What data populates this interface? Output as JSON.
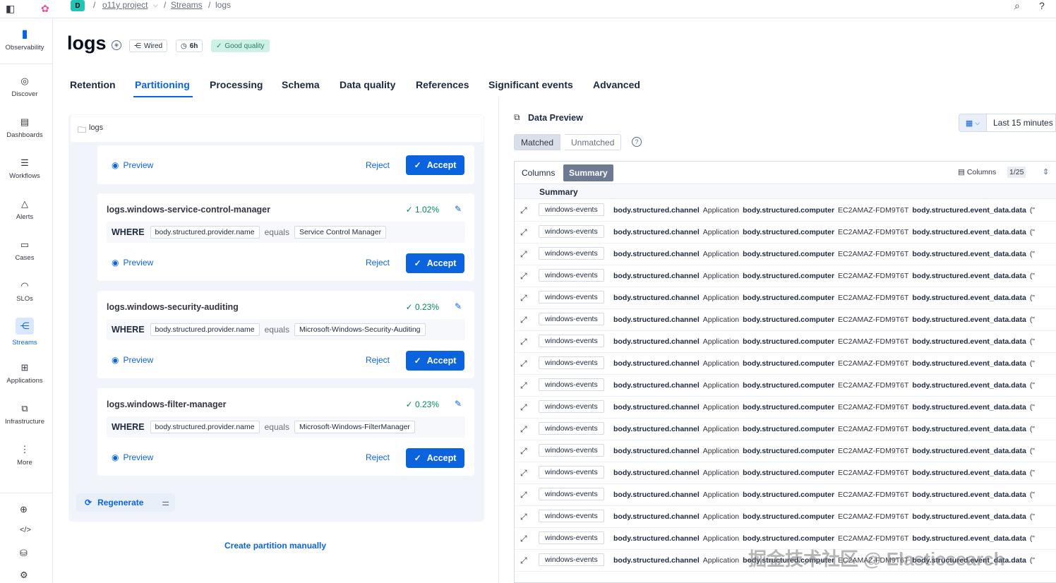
{
  "topbar": {
    "space_letter": "D",
    "crumbs": [
      "o11y project",
      "Streams",
      "logs"
    ]
  },
  "leftnav": {
    "items": [
      {
        "label": "Observability",
        "icon": "observability-icon"
      },
      {
        "label": "Discover",
        "icon": "discover-icon"
      },
      {
        "label": "Dashboards",
        "icon": "dashboards-icon"
      },
      {
        "label": "Workflows",
        "icon": "workflows-icon"
      },
      {
        "label": "Alerts",
        "icon": "alerts-icon"
      },
      {
        "label": "Cases",
        "icon": "cases-icon"
      },
      {
        "label": "SLOs",
        "icon": "slos-icon"
      },
      {
        "label": "Streams",
        "icon": "streams-icon",
        "active": true
      },
      {
        "label": "Applications",
        "icon": "applications-icon"
      },
      {
        "label": "Infrastructure",
        "icon": "infrastructure-icon"
      },
      {
        "label": "More",
        "icon": "more-icon"
      }
    ]
  },
  "header": {
    "title": "logs",
    "badges": {
      "wired": "Wired",
      "retention": "6h",
      "quality": "Good quality"
    }
  },
  "tabs": [
    "Retention",
    "Partitioning",
    "Processing",
    "Schema",
    "Data quality",
    "References",
    "Significant events",
    "Advanced"
  ],
  "active_tab": "Partitioning",
  "partitioning": {
    "root": "logs",
    "preview_label": "Preview",
    "reject_label": "Reject",
    "accept_label": "Accept",
    "where_label": "WHERE",
    "cards": [
      {
        "name": "logs.windows-service-control-manager",
        "pct": "1.02%",
        "field": "body.structured.provider.name",
        "op": "equals",
        "value": "Service Control Manager"
      },
      {
        "name": "logs.windows-security-auditing",
        "pct": "0.23%",
        "field": "body.structured.provider.name",
        "op": "equals",
        "value": "Microsoft-Windows-Security-Auditing"
      },
      {
        "name": "logs.windows-filter-manager",
        "pct": "0.23%",
        "field": "body.structured.provider.name",
        "op": "equals",
        "value": "Microsoft-Windows-FilterManager"
      }
    ],
    "regenerate_label": "Regenerate",
    "create_manual_label": "Create partition manually"
  },
  "preview": {
    "title": "Data Preview",
    "date_range": "Last 15 minutes",
    "matched": "Matched",
    "unmatched": "Unmatched",
    "view_columns": "Columns",
    "view_summary": "Summary",
    "columns_label": "Columns",
    "columns_count": "1/25",
    "summary_header": "Summary",
    "row": {
      "stream": "windows-events",
      "k1": "body.structured.channel",
      "v1": "Application",
      "k2": "body.structured.computer",
      "v2": "EC2AMAZ-FDM9T6T",
      "k3": "body.structured.event_data.data",
      "v3": "(\""
    },
    "row_count": 17
  },
  "watermark": "掘金技术社区 @ Elasticsearch"
}
